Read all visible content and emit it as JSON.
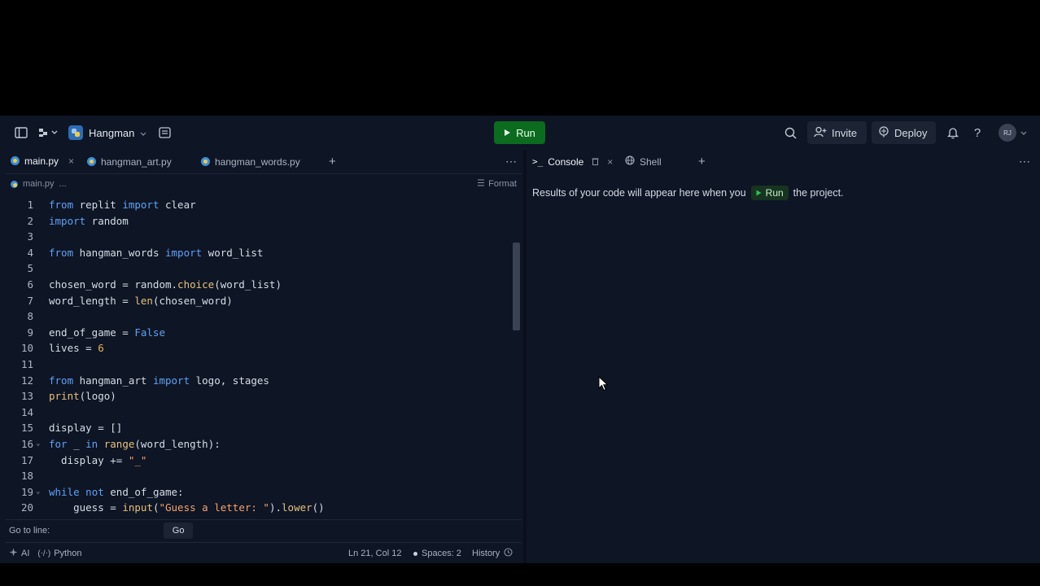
{
  "project": {
    "name": "Hangman"
  },
  "toolbar": {
    "run_label": "Run",
    "invite_label": "Invite",
    "deploy_label": "Deploy",
    "avatar_initials": "RJ",
    "help_label": "?"
  },
  "editor": {
    "tabs": [
      {
        "label": "main.py",
        "active": true
      },
      {
        "label": "hangman_art.py",
        "active": false
      },
      {
        "label": "hangman_words.py",
        "active": false
      }
    ],
    "add_tab": "+",
    "more": "⋯",
    "breadcrumb": {
      "file": "main.py",
      "rest": "..."
    },
    "format_label": "Format",
    "lines": [
      {
        "n": "1",
        "html": "<span class='kw'>from</span> replit <span class='kw'>import</span> clear"
      },
      {
        "n": "2",
        "html": "<span class='kw'>import</span> random"
      },
      {
        "n": "3",
        "html": ""
      },
      {
        "n": "4",
        "html": "<span class='kw'>from</span> hangman_words <span class='kw'>import</span> word_list"
      },
      {
        "n": "5",
        "html": ""
      },
      {
        "n": "6",
        "html": "chosen_word = random.<span class='fn'>choice</span>(word_list)"
      },
      {
        "n": "7",
        "html": "word_length = <span class='fn'>len</span>(chosen_word)"
      },
      {
        "n": "8",
        "html": ""
      },
      {
        "n": "9",
        "html": "end_of_game = <span class='kw'>False</span>"
      },
      {
        "n": "10",
        "html": "lives = <span class='num'>6</span>"
      },
      {
        "n": "11",
        "html": ""
      },
      {
        "n": "12",
        "html": "<span class='kw'>from</span> hangman_art <span class='kw'>import</span> logo, stages"
      },
      {
        "n": "13",
        "html": "<span class='fn'>print</span>(logo)"
      },
      {
        "n": "14",
        "html": ""
      },
      {
        "n": "15",
        "html": "display = []"
      },
      {
        "n": "16",
        "html": "<span class='kw'>for</span> _ <span class='kw'>in</span> <span class='fn'>range</span>(word_length):",
        "fold": true
      },
      {
        "n": "17",
        "html": "  display += <span class='str'>\"_\"</span>"
      },
      {
        "n": "18",
        "html": ""
      },
      {
        "n": "19",
        "html": "<span class='kw'>while</span> <span class='kw'>not</span> end_of_game:",
        "fold": true
      },
      {
        "n": "20",
        "html": "    guess = <span class='fn'>input</span>(<span class='str'>\"Guess a letter: \"</span>).<span class='fn'>lower</span>()"
      }
    ],
    "goto_label": "Go to line:",
    "go_button": "Go",
    "status": {
      "ai": "AI",
      "language": "Python",
      "position": "Ln 21, Col 12",
      "spaces": "Spaces: 2",
      "history": "History"
    }
  },
  "console": {
    "tabs": [
      {
        "label": "Console",
        "active": true
      },
      {
        "label": "Shell",
        "active": false
      }
    ],
    "add_tab": "+",
    "more": "⋯",
    "message_before": "Results of your code will appear here when you",
    "run_label": "Run",
    "message_after": "the project."
  }
}
